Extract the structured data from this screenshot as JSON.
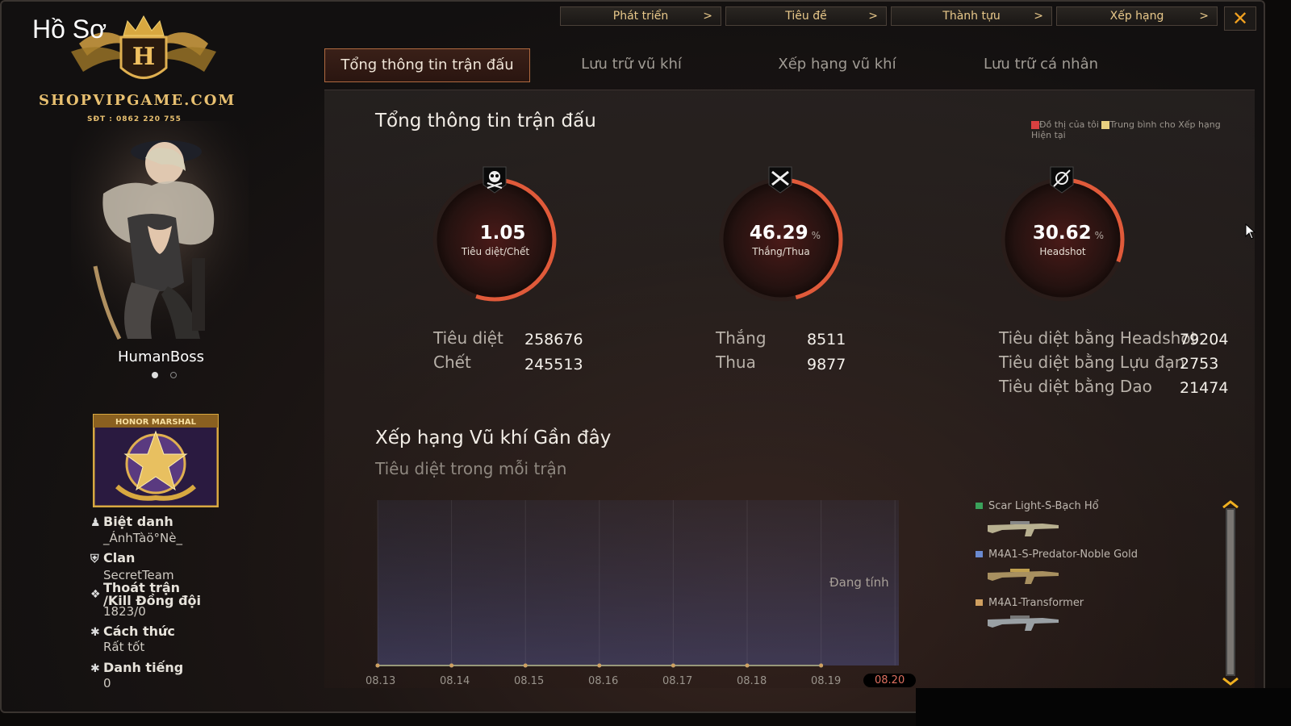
{
  "top_nav": [
    {
      "label": "Phát triển",
      "chev": ">"
    },
    {
      "label": "Tiêu đề",
      "chev": ">"
    },
    {
      "label": "Thành tựu",
      "chev": ">"
    },
    {
      "label": "Xếp hạng",
      "chev": ">"
    }
  ],
  "close_glyph": "✕",
  "logo": {
    "title": "Hồ Sơ",
    "crest_letter": "H",
    "site": "SHOPVIPGAME.COM",
    "phone": "SĐT : 0862 220 755"
  },
  "player": {
    "name": "HumanBoss"
  },
  "badge": {
    "title": "HONOR MARSHAL"
  },
  "profile": {
    "nickname_label": "Biệt danh",
    "nickname": "_ÁnhTàö°Nè_",
    "clan_label": "Clan",
    "clan": "SecretTeam",
    "quit_label_1": "Thoát trận",
    "quit_label_2": "/Kill Đồng đội",
    "quit": "1823/0",
    "manner_label": "Cách thức",
    "manner": "Rất tốt",
    "fame_label": "Danh tiếng",
    "fame": "0"
  },
  "tabs": [
    "Tổng thông tin trận đấu",
    "Lưu trữ vũ khí",
    "Xếp hạng vũ khí",
    "Lưu trữ cá nhân"
  ],
  "summary": {
    "title": "Tổng thông tin trận đấu",
    "legend_mine": "Đồ thị của tôi",
    "legend_avg": "Trung bình cho Xếp hạng Hiện tại"
  },
  "gauges": [
    {
      "value": "1.05",
      "unit": "",
      "label": "Tiêu diệt/Chết",
      "fill": 0.55,
      "icon": "skull-icon"
    },
    {
      "value": "46.29",
      "unit": "%",
      "label": "Thắng/Thua",
      "fill": 0.46,
      "icon": "crossed-guns-icon"
    },
    {
      "value": "30.62",
      "unit": "%",
      "label": "Headshot",
      "fill": 0.31,
      "icon": "headshot-icon"
    }
  ],
  "stats": {
    "kills_label": "Tiêu diệt",
    "kills": "258676",
    "deaths_label": "Chết",
    "deaths": "245513",
    "wins_label": "Thắng",
    "wins": "8511",
    "losses_label": "Thua",
    "losses": "9877",
    "hs_label": "Tiêu diệt bằng Headshot",
    "hs": "79204",
    "grenade_label": "Tiêu diệt bằng Lựu đạn",
    "grenade": "2753",
    "knife_label": "Tiêu diệt bằng Dao",
    "knife": "21474"
  },
  "recent": {
    "title": "Xếp hạng Vũ khí Gần đây",
    "subtitle": "Tiêu diệt trong mỗi trận",
    "computing": "Đang tính"
  },
  "chart_data": {
    "type": "line",
    "title": "Xếp hạng Vũ khí Gần đây",
    "ylabel": "Tiêu diệt trong mỗi trận",
    "categories": [
      "08.13",
      "08.14",
      "08.15",
      "08.16",
      "08.17",
      "08.18",
      "08.19",
      "08.20"
    ],
    "selected": "08.20",
    "series": [
      {
        "name": "Scar Light-S-Bạch Hổ",
        "color": "#3aa15a",
        "values": [
          0,
          0,
          0,
          0,
          0,
          0,
          0
        ]
      },
      {
        "name": "M4A1-S-Predator-Noble Gold",
        "color": "#6a8ad0",
        "values": [
          0,
          0,
          0,
          0,
          0,
          0,
          0
        ]
      },
      {
        "name": "M4A1-Transformer",
        "color": "#d0a060",
        "values": [
          0,
          0,
          0,
          0,
          0,
          0,
          0
        ]
      }
    ]
  },
  "weapons": [
    {
      "name": "Scar Light-S-Bạch Hổ",
      "color": "#3aa15a"
    },
    {
      "name": "M4A1-S-Predator-Noble Gold",
      "color": "#6a8ad0"
    },
    {
      "name": "M4A1-Transformer",
      "color": "#d0a060"
    }
  ]
}
